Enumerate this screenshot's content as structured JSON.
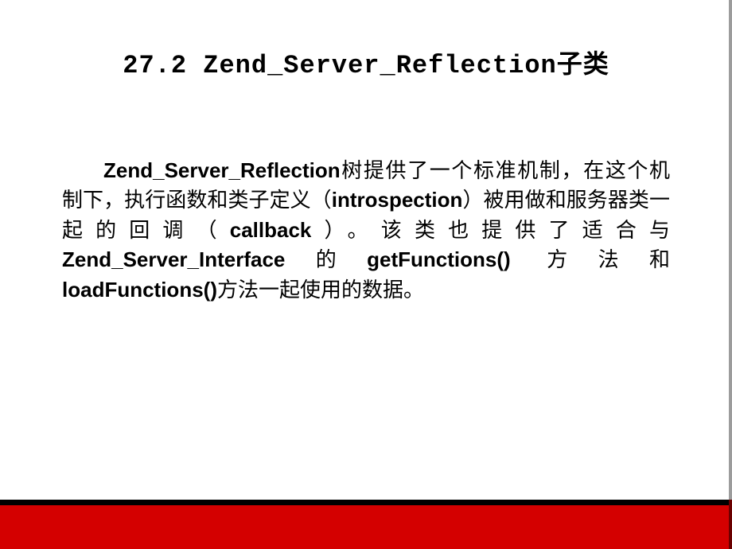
{
  "slide": {
    "title": "27.2  Zend_Server_Reflection子类",
    "paragraph": {
      "part1_bold": "Zend_Server_Reflection",
      "part2": "树提供了一个标准机制，在这个机制下，执行函数和类子定义（",
      "part3_bold": "introspection",
      "part4": "）被用做和服务器类一起的回调（",
      "part5_bold": "callback",
      "part6": "）。该类也提供了适合与",
      "part7_bold": "Zend_Server_Interface",
      "part8": "的",
      "part9_bold": "getFunctions() ",
      "part10": "方法和",
      "part11_bold": "loadFunctions()",
      "part12": "方法一起使用的数据。"
    }
  }
}
